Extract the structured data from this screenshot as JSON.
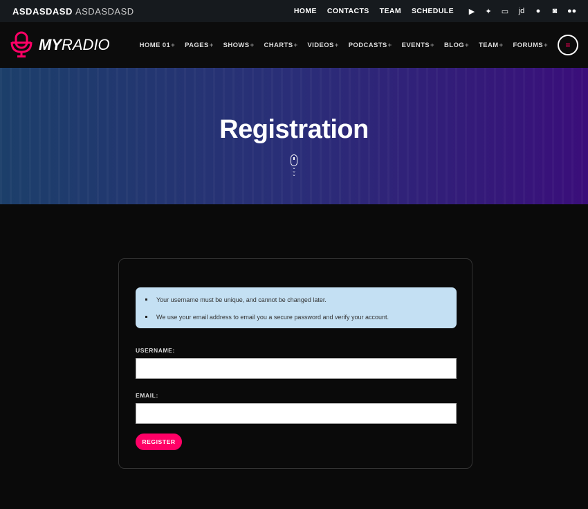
{
  "topbar": {
    "brand_bold": "ASDASDASD",
    "brand_light": "ASDASDASD",
    "links": [
      "HOME",
      "CONTACTS",
      "TEAM",
      "SCHEDULE"
    ],
    "social_icons": [
      "youtube-icon",
      "twitter-icon",
      "twitch-icon",
      "jd-icon",
      "apple-icon",
      "instagram-icon",
      "flickr-icon"
    ],
    "social_glyphs": [
      "▶",
      "🐦",
      "▭",
      "jd",
      "",
      "◙",
      "●●"
    ]
  },
  "nav": {
    "logo_bold": "MY",
    "logo_light": "RADIO",
    "items": [
      "HOME 01",
      "PAGES",
      "SHOWS",
      "CHARTS",
      "VIDEOS",
      "PODCASTS",
      "EVENTS",
      "BLOG",
      "TEAM",
      "FORUMS"
    ],
    "plus": "+",
    "menu_glyph": "≡"
  },
  "hero": {
    "title": "Registration"
  },
  "form": {
    "notices": [
      "Your username must be unique, and cannot be changed later.",
      "We use your email address to email you a secure password and verify your account."
    ],
    "username_label": "USERNAME:",
    "username_value": "",
    "email_label": "EMAIL:",
    "email_value": "",
    "submit": "REGISTER"
  },
  "colors": {
    "accent": "#ff0066",
    "notice_bg": "#c4e0f3"
  }
}
